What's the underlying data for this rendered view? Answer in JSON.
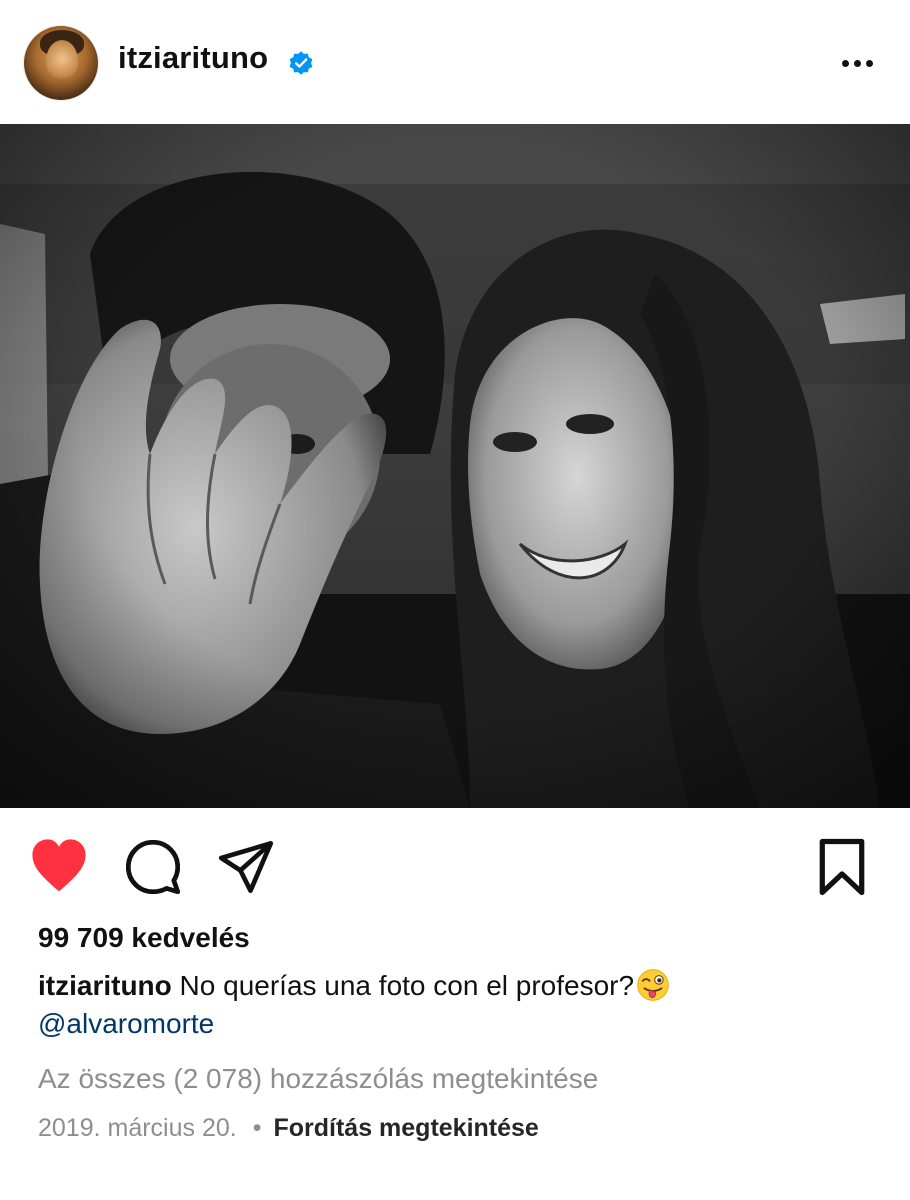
{
  "post": {
    "username": "itziarituno",
    "verified": true,
    "more_icon": "more-horizontal-icon",
    "photo_description": "",
    "likes_text": "99 709 kedvelés",
    "caption_user": "itziarituno",
    "caption_text": "No querías una foto con el profesor?",
    "caption_emoji": "winking-face-with-tongue",
    "mention": "@alvaromorte",
    "view_all_comments": "Az összes (2 078) hozzászólás megtekintése",
    "date": "2019. március 20.",
    "separator": "•",
    "translate_label": "Fordítás megtekintése"
  },
  "colors": {
    "like_red": "#ff3040",
    "link_blue": "#00376b",
    "muted_gray": "#8e8e8e",
    "verified_blue": "#0095f6"
  }
}
